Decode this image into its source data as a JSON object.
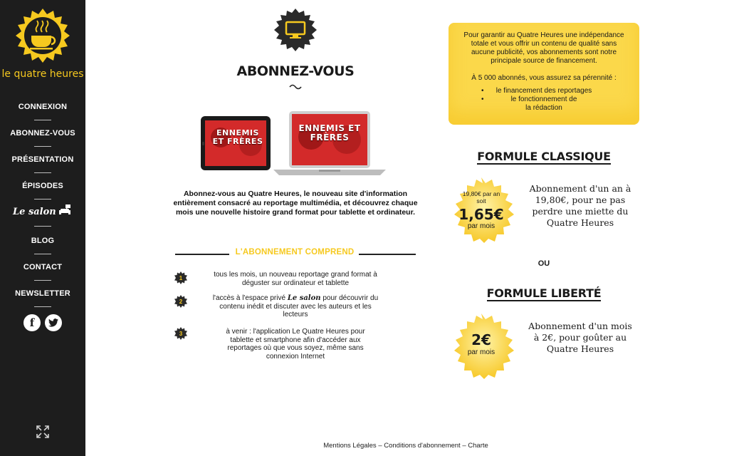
{
  "brand": {
    "logo_text": "le quatre heures"
  },
  "nav": {
    "items": [
      {
        "label": "CONNEXION"
      },
      {
        "label": "ABONNEZ-VOUS"
      },
      {
        "label": "PRÉSENTATION"
      },
      {
        "label": "ÉPISODES"
      },
      {
        "label": "Le salon"
      },
      {
        "label": "BLOG"
      },
      {
        "label": "CONTACT"
      },
      {
        "label": "NEWSLETTER"
      }
    ],
    "social": {
      "facebook": "f",
      "twitter": "t"
    }
  },
  "main": {
    "heading": "ABONNEZ-VOUS",
    "device_title": "ENNEMIS ET FRÈRES",
    "intro": "Abonnez-vous au Quatre Heures, le nouveau site d'information entièrement consacré au reportage multimédia, et découvrez chaque mois une nouvelle histoire grand format pour tablette et ordinateur.",
    "comprend_title": "L'ABONNEMENT COMPREND",
    "items": [
      {
        "number": "1",
        "text": "tous les mois, un nouveau reportage grand format à déguster sur ordinateur et tablette"
      },
      {
        "number": "2",
        "text_before": "l'accès à l'espace privé ",
        "salon": "Le salon",
        "text_after": " pour découvrir du contenu inédit et discuter avec les auteurs et les lecteurs"
      },
      {
        "number": "3",
        "text": "à venir : l'application Le Quatre Heures pour tablette et smartphone afin d'accéder aux reportages où que vous soyez, même sans connexion Internet"
      }
    ]
  },
  "sidebar_right": {
    "info_para1": "Pour garantir au Quatre Heures une indépendance totale et vous offrir un contenu de qualité sans aucune publicité, vos abonnements sont notre principale source de financement.",
    "info_para2": "À 5 000 abonnés, vous assurez sa pérennité :",
    "info_bullets": [
      "le financement des reportages",
      "le fonctionnement de la rédaction"
    ],
    "formule1": {
      "title": "FORMULE CLASSIQUE",
      "badge_small": "19,80€ par an soit",
      "badge_price": "1,65€",
      "badge_unit": "par mois",
      "desc": "Abonnement d'un an à 19,80€, pour ne pas perdre une miette du Quatre Heures"
    },
    "ou": "OU",
    "formule2": {
      "title": "FORMULE LIBERTÉ",
      "badge_price": "2€",
      "badge_unit": "par mois",
      "desc": "Abonnement d'un mois à 2€, pour goûter au Quatre Heures"
    }
  },
  "footer": {
    "links": [
      "Mentions Légales",
      "Conditions d'abonnement",
      "Charte"
    ],
    "separator": " – "
  },
  "colors": {
    "accent": "#f6c91f",
    "sidebar_bg": "#1d1d1d",
    "box_bg": "#fbd84a"
  }
}
